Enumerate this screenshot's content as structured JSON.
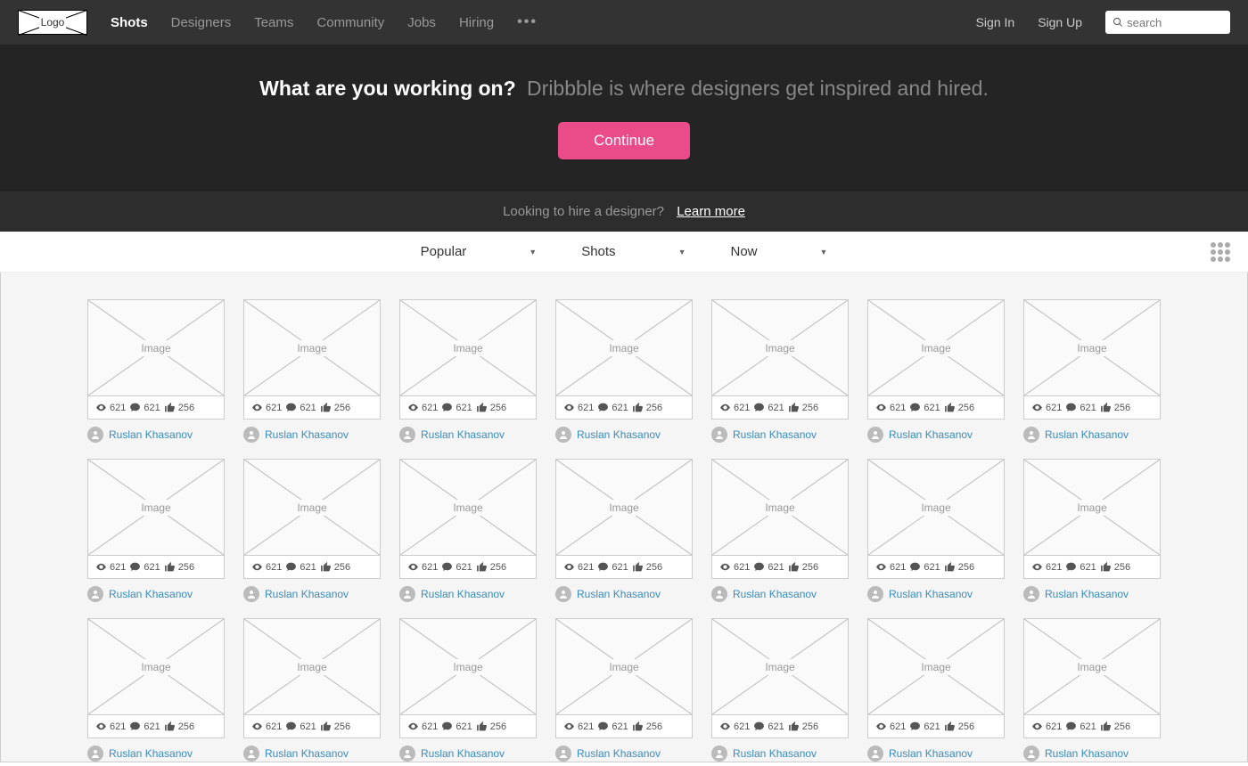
{
  "nav": {
    "logo": "Logo",
    "items": [
      "Shots",
      "Designers",
      "Teams",
      "Community",
      "Jobs",
      "Hiring"
    ],
    "active_index": 0,
    "signin": "Sign In",
    "signup": "Sign Up",
    "search_placeholder": "search"
  },
  "hero": {
    "question": "What are you working on?",
    "tagline": "Dribbble is where designers get inspired and hired.",
    "cta": "Continue"
  },
  "hire": {
    "question": "Looking to hire a designer?",
    "link": "Learn more"
  },
  "filters": {
    "sort": "Popular",
    "type": "Shots",
    "time": "Now"
  },
  "shot_defaults": {
    "img_label": "Image",
    "views": "621",
    "comments": "621",
    "likes": "256",
    "author": "Ruslan Khasanov"
  },
  "shot_count": 21
}
